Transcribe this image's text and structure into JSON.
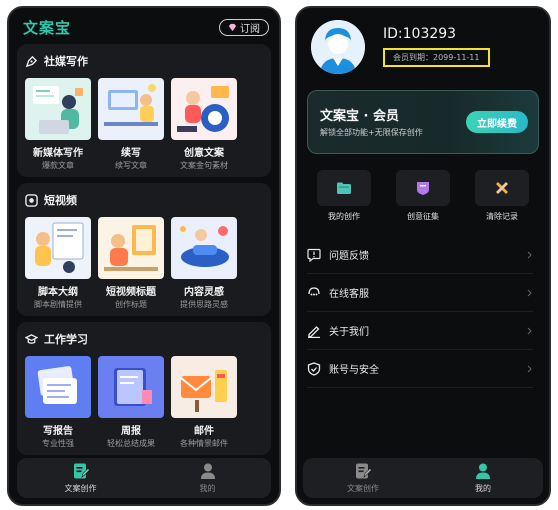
{
  "left": {
    "app_title": "文案宝",
    "subscribe_label": "订阅",
    "sections": [
      {
        "title": "社媒写作",
        "icon": "pen-nib-icon",
        "cards": [
          {
            "title": "新媒体写作",
            "sub": "爆款文章"
          },
          {
            "title": "续写",
            "sub": "续写文章"
          },
          {
            "title": "创意文案",
            "sub": "文案金句素材"
          }
        ]
      },
      {
        "title": "短视频",
        "icon": "video-icon",
        "cards": [
          {
            "title": "脚本大纲",
            "sub": "脚本剧情提供"
          },
          {
            "title": "短视频标题",
            "sub": "创作标题"
          },
          {
            "title": "内容灵感",
            "sub": "提供思路灵感"
          }
        ]
      },
      {
        "title": "工作学习",
        "icon": "graduation-cap-icon",
        "cards": [
          {
            "title": "写报告",
            "sub": "专业性强"
          },
          {
            "title": "周报",
            "sub": "轻松总结成果"
          },
          {
            "title": "邮件",
            "sub": "各种情景邮件"
          }
        ]
      }
    ],
    "nav": [
      {
        "label": "文案创作",
        "active": true
      },
      {
        "label": "我的",
        "active": false
      }
    ]
  },
  "right": {
    "user_id": "ID:103293",
    "member_expiry": "会员到期：2099-11-11",
    "member_card": {
      "title": "文案宝 · 会员",
      "desc": "解锁全部功能+无限保存创作",
      "button": "立即续费"
    },
    "quick_actions": [
      {
        "label": "我的创作",
        "icon": "folder-icon"
      },
      {
        "label": "创意征集",
        "icon": "shield-badge-icon"
      },
      {
        "label": "清除记录",
        "icon": "clear-icon"
      }
    ],
    "menu": [
      {
        "label": "问题反馈",
        "icon": "feedback-icon"
      },
      {
        "label": "在线客服",
        "icon": "customer-service-icon"
      },
      {
        "label": "关于我们",
        "icon": "edit-icon"
      },
      {
        "label": "账号与安全",
        "icon": "shield-check-icon"
      }
    ],
    "nav": [
      {
        "label": "文案创作",
        "active": false
      },
      {
        "label": "我的",
        "active": true
      }
    ]
  },
  "colors": {
    "accent": "#33c6a8",
    "background": "#0c0d0f",
    "card": "#1a1b1e",
    "highlight_box": "#f3e232"
  }
}
